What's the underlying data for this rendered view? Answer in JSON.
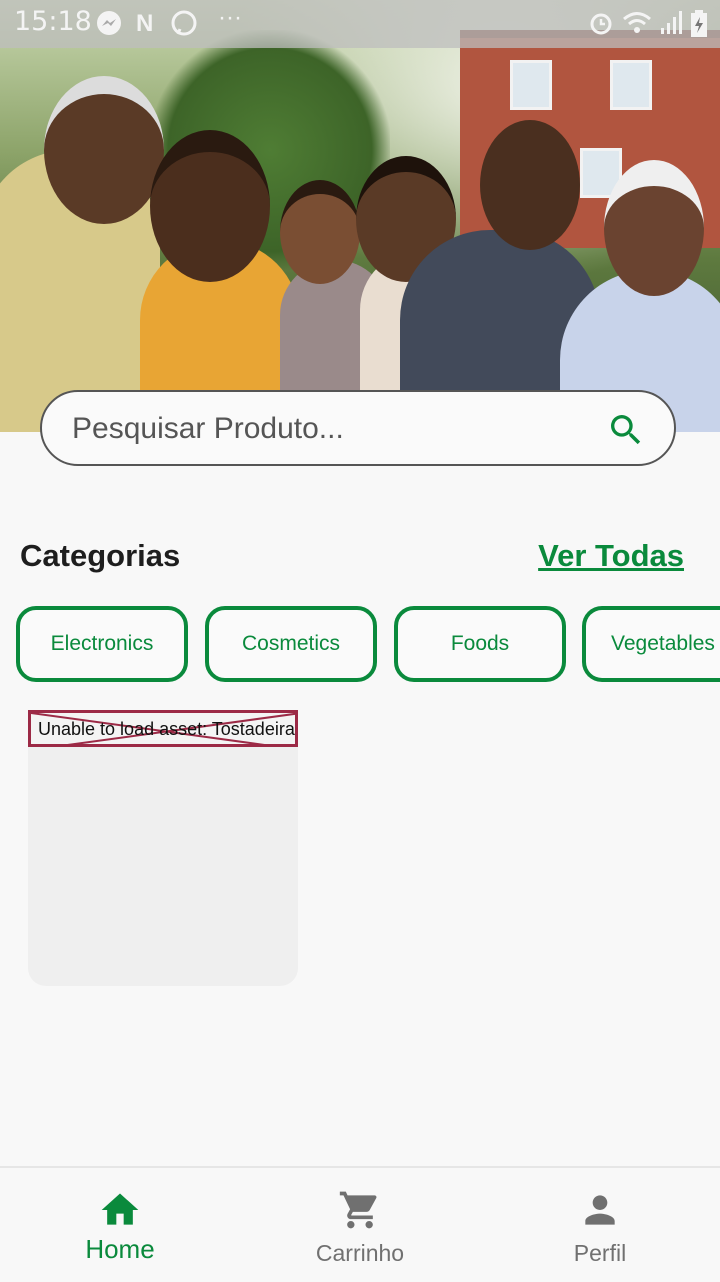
{
  "status_bar": {
    "time": "15:18"
  },
  "search": {
    "placeholder": "Pesquisar Produto..."
  },
  "categories": {
    "title": "Categorias",
    "see_all": "Ver Todas",
    "items": [
      "Electronics",
      "Cosmetics",
      "Foods",
      "Vegetables"
    ]
  },
  "products": [
    {
      "image_error": "Unable to load asset: Tostadeira"
    }
  ],
  "bottom_nav": {
    "items": [
      {
        "label": "Home",
        "icon": "home-icon",
        "active": true
      },
      {
        "label": "Carrinho",
        "icon": "cart-icon",
        "active": false
      },
      {
        "label": "Perfil",
        "icon": "person-icon",
        "active": false
      }
    ]
  },
  "colors": {
    "primary": "#0a8a3c",
    "inactive": "#707070",
    "background": "#f8f8f8"
  }
}
